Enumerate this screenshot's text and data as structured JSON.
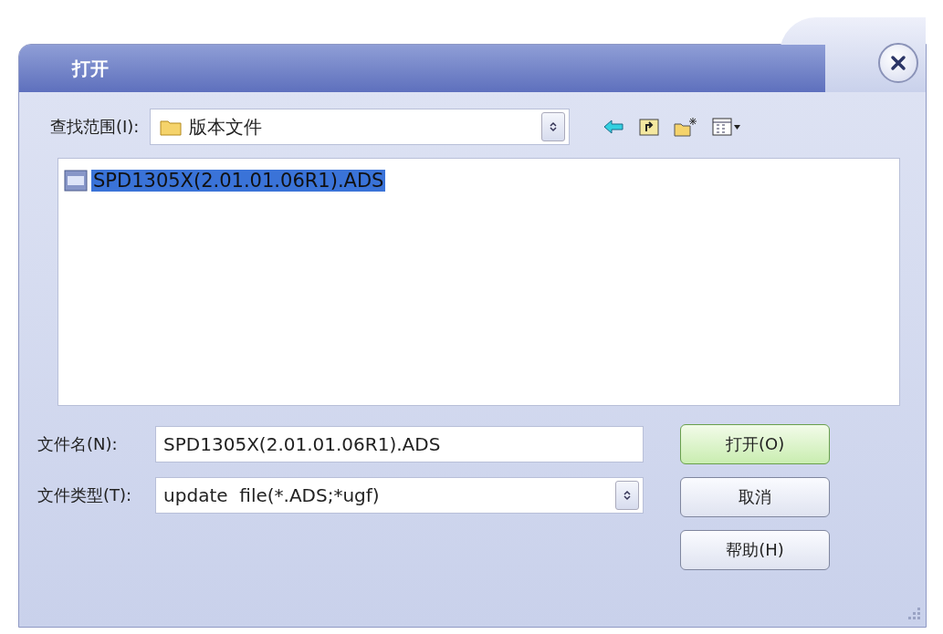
{
  "window": {
    "title": "打开"
  },
  "look_in": {
    "label": "查找范围(I):",
    "value": "版本文件"
  },
  "files": [
    {
      "name": "SPD1305X(2.01.01.06R1).ADS",
      "selected": true
    }
  ],
  "file_name": {
    "label": "文件名(N):",
    "value": "SPD1305X(2.01.01.06R1).ADS"
  },
  "file_type": {
    "label": "文件类型(T):",
    "value": "update  file(*.ADS;*ugf)"
  },
  "buttons": [
    {
      "label": "打开(O)",
      "default": true
    },
    {
      "label": "取消",
      "default": false
    },
    {
      "label": "帮助(H)",
      "default": false
    }
  ]
}
